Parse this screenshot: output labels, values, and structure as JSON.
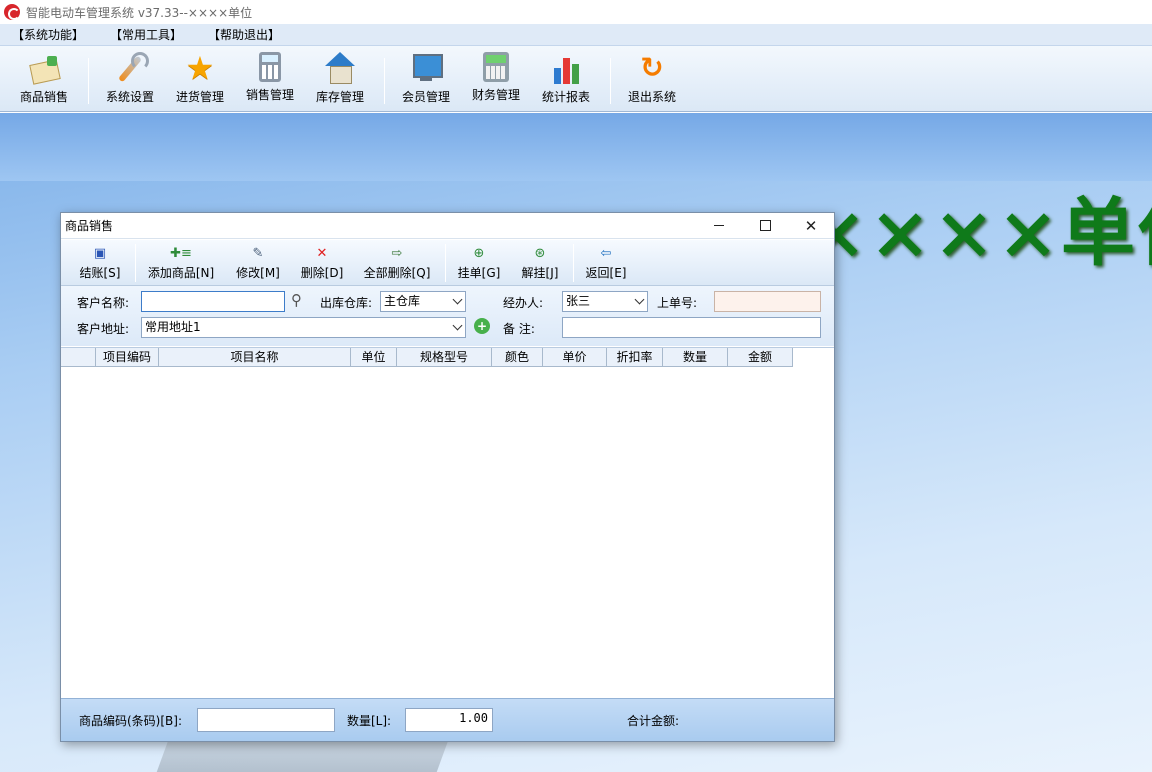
{
  "window": {
    "title": "智能电动车管理系统 v37.33--××××单位"
  },
  "menu": [
    "【系统功能】",
    "【常用工具】",
    "【帮助退出】"
  ],
  "toolbar": {
    "items": [
      {
        "label": "商品销售",
        "icon": "sale-icon"
      },
      {
        "label": "系统设置",
        "icon": "settings-icon"
      },
      {
        "label": "进货管理",
        "icon": "star-icon"
      },
      {
        "label": "销售管理",
        "icon": "calculator-icon"
      },
      {
        "label": "库存管理",
        "icon": "house-icon"
      },
      {
        "label": "会员管理",
        "icon": "monitor-icon"
      },
      {
        "label": "财务管理",
        "icon": "finance-icon"
      },
      {
        "label": "统计报表",
        "icon": "bar-chart-icon"
      },
      {
        "label": "退出系统",
        "icon": "exit-icon"
      }
    ]
  },
  "desktop": {
    "company_name": "××××单位",
    "brand_color": "#0f7a1a"
  },
  "dialog": {
    "title": "商品销售",
    "toolbar": [
      {
        "label": "结账[S]",
        "icon": "save-icon"
      },
      {
        "label": "添加商品[N]",
        "icon": "add-item-icon"
      },
      {
        "label": "修改[M]",
        "icon": "edit-icon"
      },
      {
        "label": "删除[D]",
        "icon": "delete-icon"
      },
      {
        "label": "全部删除[Q]",
        "icon": "delete-all-icon"
      },
      {
        "label": "挂单[G]",
        "icon": "hold-order-icon"
      },
      {
        "label": "解挂[J]",
        "icon": "release-order-icon"
      },
      {
        "label": "返回[E]",
        "icon": "return-icon"
      }
    ],
    "form": {
      "customer_label": "客户名称:",
      "customer_value": "",
      "warehouse_label": "出库仓库:",
      "warehouse_value": "主仓库",
      "handler_label": "经办人:",
      "handler_value": "张三",
      "prev_order_label": "上单号:",
      "prev_order_value": "",
      "address_label": "客户地址:",
      "address_value": "常用地址1",
      "remark_label": "备  注:",
      "remark_value": ""
    },
    "grid": {
      "columns": [
        "",
        "项目编码",
        "项目名称",
        "单位",
        "规格型号",
        "颜色",
        "单价",
        "折扣率",
        "数量",
        "金额"
      ],
      "rows": []
    },
    "footer": {
      "barcode_label": "商品编码(条码)[B]:",
      "barcode_value": "",
      "qty_label": "数量[L]:",
      "qty_value": "1.00",
      "total_label": "合计金额:"
    }
  }
}
